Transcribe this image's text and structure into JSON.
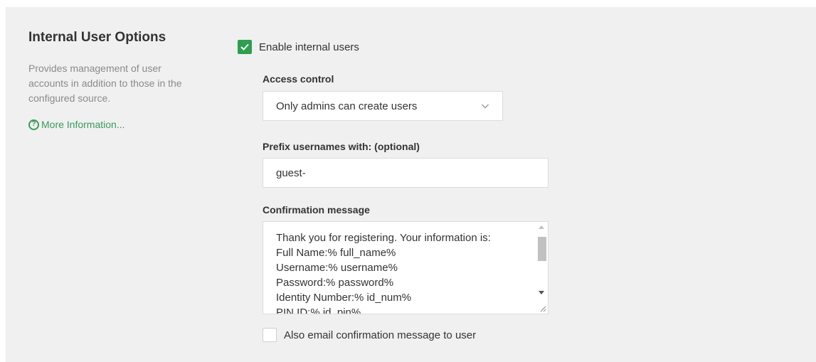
{
  "section": {
    "title": "Internal User Options",
    "description": "Provides management of user accounts in addition to those in the configured source.",
    "more_info_label": "More Information...",
    "more_info_icon": "help-circle-icon"
  },
  "enable_internal_users": {
    "label": "Enable internal users",
    "checked": true
  },
  "access_control": {
    "label": "Access control",
    "selected": "Only admins can create users"
  },
  "prefix": {
    "label": "Prefix usernames with: (optional)",
    "value": "guest-"
  },
  "confirmation": {
    "label": "Confirmation message",
    "value": "Thank you for registering. Your information is:\nFull Name:% full_name%\nUsername:% username%\nPassword:% password%\nIdentity Number:% id_num%\nPIN ID:% id_pin%"
  },
  "email_confirmation": {
    "label": "Also email confirmation message to user",
    "checked": false
  },
  "colors": {
    "accent_green": "#2e9e4f",
    "link_green": "#3a9a5b",
    "panel_bg": "#f0f0f0"
  }
}
